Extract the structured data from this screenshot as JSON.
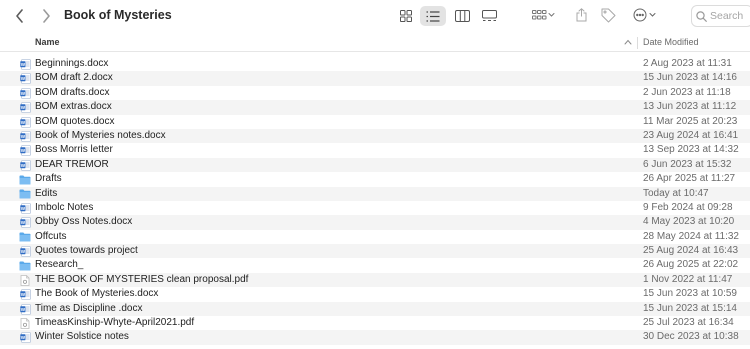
{
  "window": {
    "title": "Book of Mysteries"
  },
  "search": {
    "placeholder": "Search"
  },
  "columns": {
    "name": "Name",
    "date_modified": "Date Modified"
  },
  "colors": {
    "folder": "#5aa9ea",
    "word": "#2f6cc4",
    "selected_view": "#e3e3e3"
  },
  "toolbar_icons": [
    "back-icon",
    "forward-icon",
    "grid-view-icon",
    "list-view-icon",
    "column-view-icon",
    "gallery-view-icon",
    "group-icon",
    "share-icon",
    "tag-icon",
    "more-icon",
    "search-icon"
  ],
  "files": [
    {
      "name": "Beginnings.docx",
      "date": "2 Aug 2023 at 11:31",
      "kind": "word"
    },
    {
      "name": "BOM draft 2.docx",
      "date": "15 Jun 2023 at 14:16",
      "kind": "word"
    },
    {
      "name": "BOM drafts.docx",
      "date": "2 Jun 2023 at 11:18",
      "kind": "word"
    },
    {
      "name": "BOM extras.docx",
      "date": "13 Jun 2023 at 11:12",
      "kind": "word"
    },
    {
      "name": "BOM quotes.docx",
      "date": "11 Mar 2025 at 20:23",
      "kind": "word"
    },
    {
      "name": "Book of Mysteries notes.docx",
      "date": "23 Aug 2024 at 16:41",
      "kind": "word"
    },
    {
      "name": "Boss Morris letter",
      "date": "13 Sep 2023 at 14:32",
      "kind": "word"
    },
    {
      "name": "DEAR TREMOR",
      "date": "6 Jun 2023 at 15:32",
      "kind": "word"
    },
    {
      "name": "Drafts",
      "date": "26 Apr 2025 at 11:27",
      "kind": "folder"
    },
    {
      "name": "Edits",
      "date": "Today at 10:47",
      "kind": "folder"
    },
    {
      "name": "Imbolc Notes",
      "date": "9 Feb 2024 at 09:28",
      "kind": "word"
    },
    {
      "name": "Obby Oss Notes.docx",
      "date": "4 May 2023 at 10:20",
      "kind": "word"
    },
    {
      "name": "Offcuts",
      "date": "28 May 2024 at 11:32",
      "kind": "folder"
    },
    {
      "name": "Quotes towards project",
      "date": "25 Aug 2024 at 16:43",
      "kind": "word"
    },
    {
      "name": "Research_",
      "date": "26 Aug 2025 at 22:02",
      "kind": "folder"
    },
    {
      "name": "THE BOOK OF MYSTERIES clean proposal.pdf",
      "date": "1 Nov 2022 at 11:47",
      "kind": "pdf"
    },
    {
      "name": "The Book of Mysteries.docx",
      "date": "15 Jun 2023 at 10:59",
      "kind": "word"
    },
    {
      "name": "Time as Discipline .docx",
      "date": "15 Jun 2023 at 15:14",
      "kind": "word"
    },
    {
      "name": "TimeasKinship-Whyte-April2021.pdf",
      "date": "25 Jul 2023 at 16:34",
      "kind": "pdf"
    },
    {
      "name": "Winter Solstice notes",
      "date": "30 Dec 2023 at 10:38",
      "kind": "word"
    }
  ]
}
